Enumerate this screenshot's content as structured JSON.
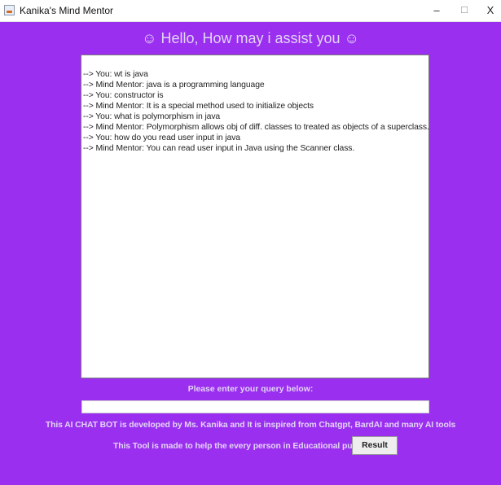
{
  "window": {
    "title": "Kanika's Mind Mentor",
    "minimize_glyph": "–",
    "maximize_glyph": "☐",
    "close_glyph": "X",
    "icon": "java-cup-icon"
  },
  "header": {
    "text": "☺ Hello, How may i assist you ☺"
  },
  "chat": {
    "lines": [
      "--> You:  wt is java",
      "--> Mind Mentor:  java is a programming language",
      "--> You:  constructor is",
      "--> Mind Mentor:  It is a special method used to initialize objects",
      "--> You:  what is polymorphism in java",
      "--> Mind Mentor:  Polymorphism allows obj of diff. classes to treated as objects of a superclass.",
      "--> You:  how do you read user input in java",
      "--> Mind Mentor:  You can read user input in Java using the Scanner class."
    ]
  },
  "query": {
    "label": "Please enter your query below:",
    "value": "",
    "placeholder": ""
  },
  "footer": {
    "developer_text": "This AI CHAT BOT is developed by Ms. Kanika   and It is inspired from Chatgpt, BardAI and many AI tools",
    "purpose_text": "This Tool is made to help the every person in Educational purpose",
    "result_button": "Result"
  },
  "colors": {
    "background": "#9b2ff0",
    "text_light": "#e2d4f5"
  }
}
